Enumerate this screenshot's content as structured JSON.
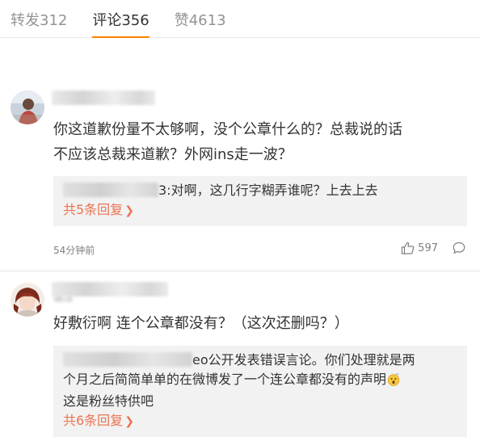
{
  "tabs": [
    {
      "label": "转发312"
    },
    {
      "label": "评论356"
    },
    {
      "label": "赞4613"
    }
  ],
  "comments": [
    {
      "text_line1": "你这道歉份量不太够啊，没个公章什么的？总裁说的话",
      "text_line2": "不应该总裁来道歉？外网ins走一波？",
      "reply_text": "3:对啊，这几行字糊弄谁呢？上去上去",
      "reply_more": "共5条回复",
      "time": "54分钟前",
      "likes": "597"
    },
    {
      "text_line1": "好敷衍啊 连个公章都没有？（这次还删吗？）",
      "reply_line1": "eo公开发表错误言论。你们处理就是两",
      "reply_line2": "个月之后简简单单的在微博发了一个连公章都没有的声明",
      "reply_line3": "这是粉丝特供吧",
      "reply_more": "共6条回复"
    }
  ],
  "icons": {
    "thumb": "thumb-up-icon",
    "comment": "comment-icon",
    "chevron": "chevron-right-icon",
    "emoji": "shocked-emoji-icon"
  },
  "colors": {
    "accent": "#ff8200",
    "link": "#eb7350"
  }
}
